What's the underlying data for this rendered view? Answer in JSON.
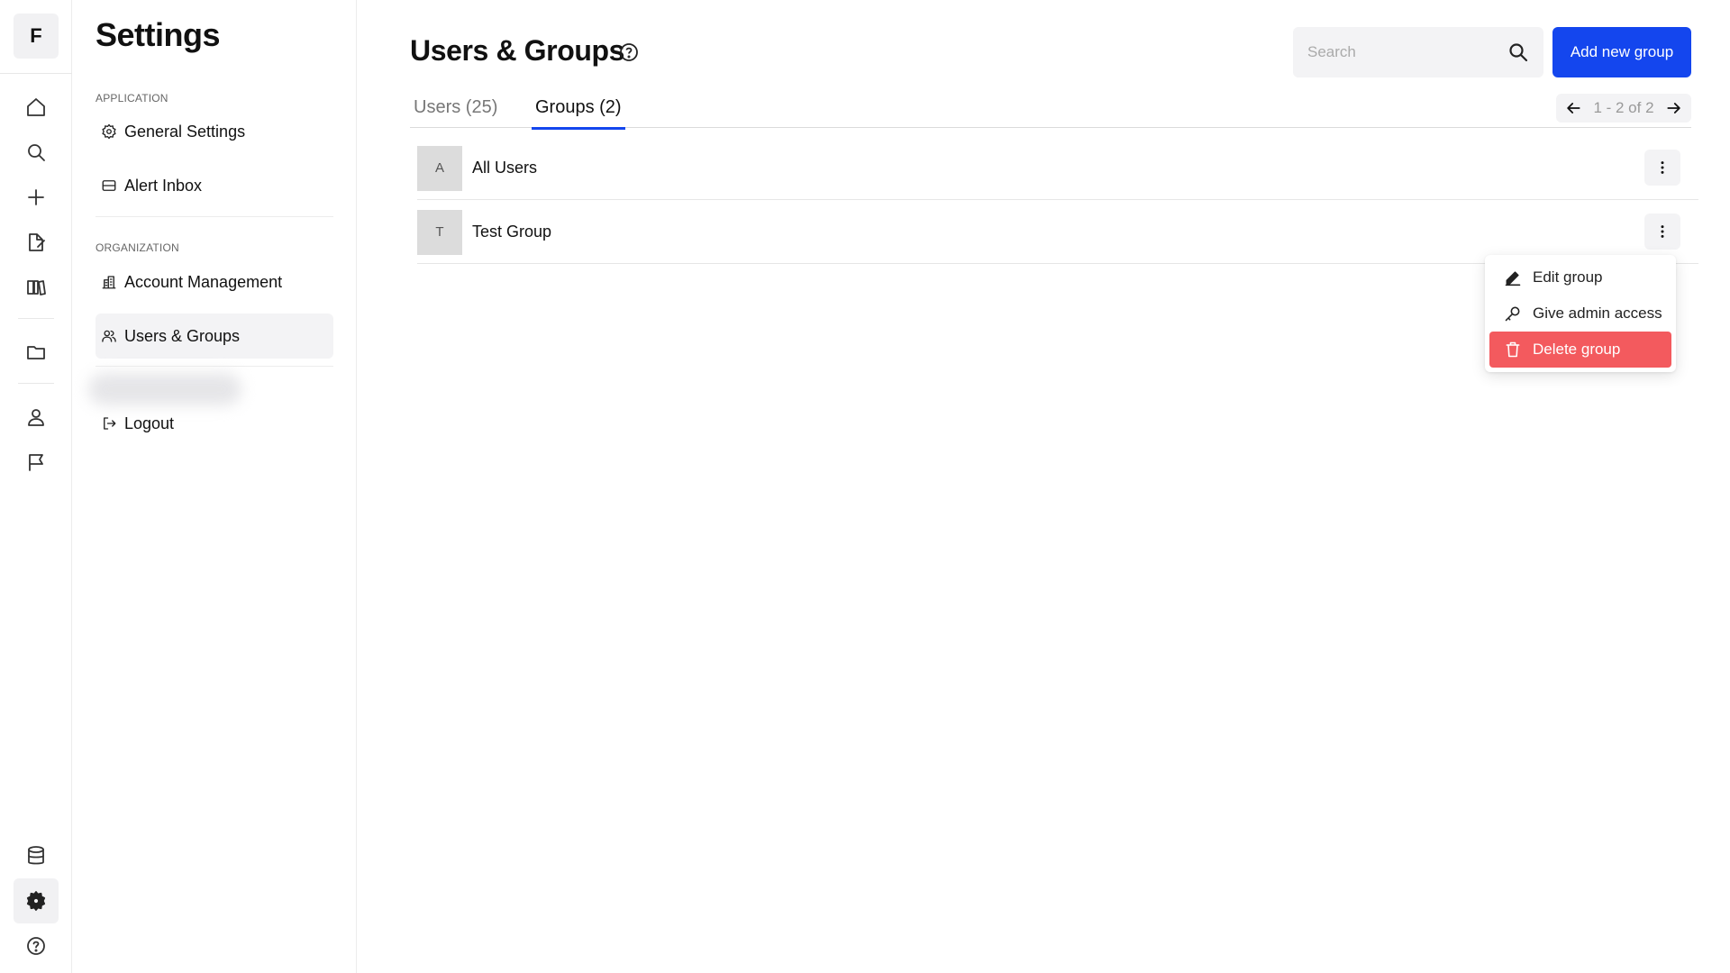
{
  "rail": {
    "logo_letter": "F",
    "icons": [
      "home-icon",
      "search-icon",
      "plus-icon",
      "edit-document-icon",
      "catalog-icon",
      "folder-icon",
      "user-icon",
      "flag-icon",
      "database-icon",
      "gear-icon",
      "help-icon"
    ],
    "active": "gear-icon"
  },
  "sidebar": {
    "title": "Settings",
    "sections": [
      {
        "label": "APPLICATION",
        "items": [
          {
            "label": "General Settings",
            "icon": "gear-icon"
          },
          {
            "label": "Alert Inbox",
            "icon": "inbox-icon"
          }
        ]
      },
      {
        "label": "ORGANIZATION",
        "items": [
          {
            "label": "Account Management",
            "icon": "building-icon"
          },
          {
            "label": "Users & Groups",
            "icon": "users-icon",
            "active": true
          }
        ]
      }
    ],
    "logout_label": "Logout"
  },
  "main": {
    "title": "Users & Groups",
    "search": {
      "placeholder": "Search",
      "value": ""
    },
    "add_button_label": "Add new group",
    "tabs": [
      {
        "label": "Users (25)",
        "active": false
      },
      {
        "label": "Groups (2)",
        "active": true
      }
    ],
    "pagination": "1 - 2 of 2",
    "groups": [
      {
        "initial": "A",
        "name": "All Users"
      },
      {
        "initial": "T",
        "name": "Test Group"
      }
    ],
    "context_menu": {
      "items": [
        {
          "label": "Edit group",
          "icon": "pencil-icon"
        },
        {
          "label": "Give admin access",
          "icon": "key-icon"
        },
        {
          "label": "Delete group",
          "icon": "trash-icon",
          "danger": true
        }
      ]
    }
  },
  "colors": {
    "primary": "#1446ee",
    "danger": "#f35a5e",
    "surface": "#f3f3f5"
  }
}
